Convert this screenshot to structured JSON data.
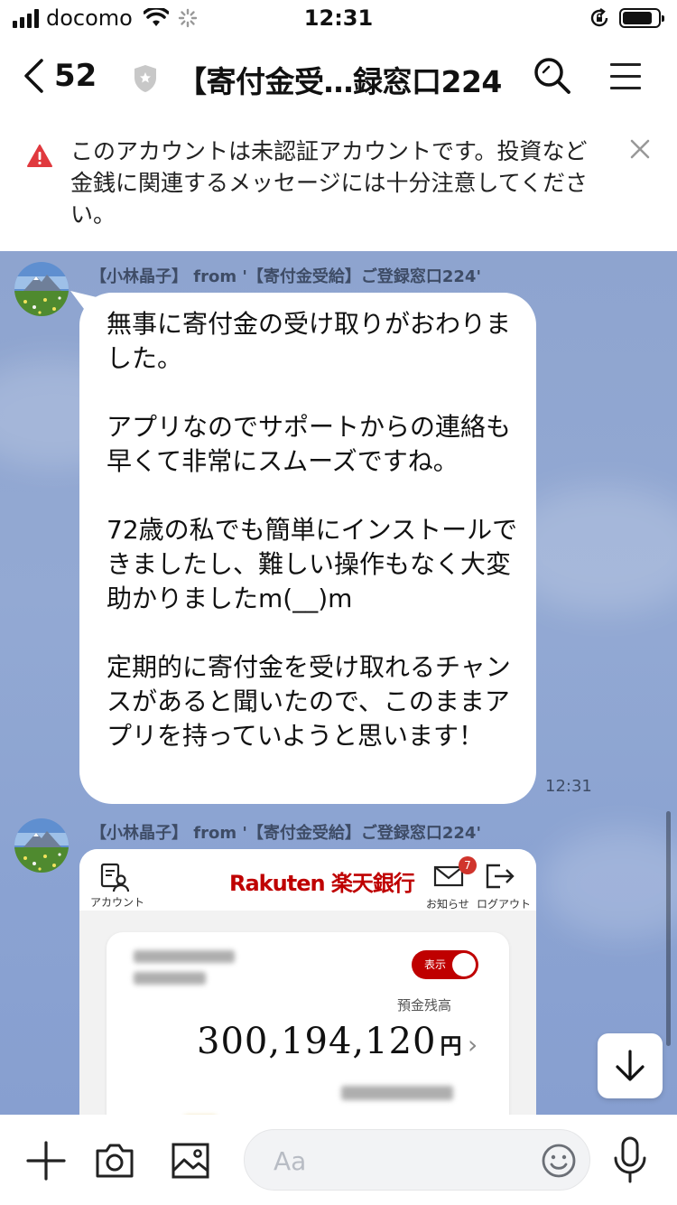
{
  "status_bar": {
    "carrier": "docomo",
    "time": "12:31"
  },
  "header": {
    "back_count": "52",
    "title": "【寄付金受…録窓口224"
  },
  "warning": {
    "text": "このアカウントは未認証アカウントです。投資など金銭に関連するメッセージには十分注意してください。"
  },
  "messages": [
    {
      "sender": "【小林晶子】 from '【寄付金受給】ご登録窓口224'",
      "paragraphs": [
        "無事に寄付金の受け取りがおわりました。",
        "アプリなのでサポートからの連絡も早くて非常にスムーズですね。",
        "72歳の私でも簡単にインストールできましたし、難しい操作もなく大変助かりましたm(__)m",
        "定期的に寄付金を受け取れるチャンスがあると聞いたので、このままアプリを持っていようと思います！"
      ],
      "time": "12:31"
    },
    {
      "sender": "【小林晶子】 from '【寄付金受給】ご登録窓口224'",
      "image": {
        "account_label": "アカウント",
        "bank_logo": "Rakuten 楽天銀行",
        "notice_badge": "7",
        "notice_label": "お知らせ",
        "logout_label": "ログアウト",
        "toggle_label": "表示",
        "balance_label": "預金残高",
        "balance_amount": "300,194,120",
        "balance_unit": "円"
      }
    }
  ],
  "input": {
    "placeholder": "Aa"
  },
  "icons": [
    "chevron-left-icon",
    "shield-icon",
    "search-icon",
    "menu-icon",
    "warning-icon",
    "close-icon",
    "plus-icon",
    "camera-icon",
    "image-icon",
    "emoji-icon",
    "mic-icon",
    "arrow-down-icon"
  ],
  "colors": {
    "chat_background": "#8ea4cf",
    "warning_red": "#e0393e",
    "rakuten_red": "#bf0000"
  }
}
